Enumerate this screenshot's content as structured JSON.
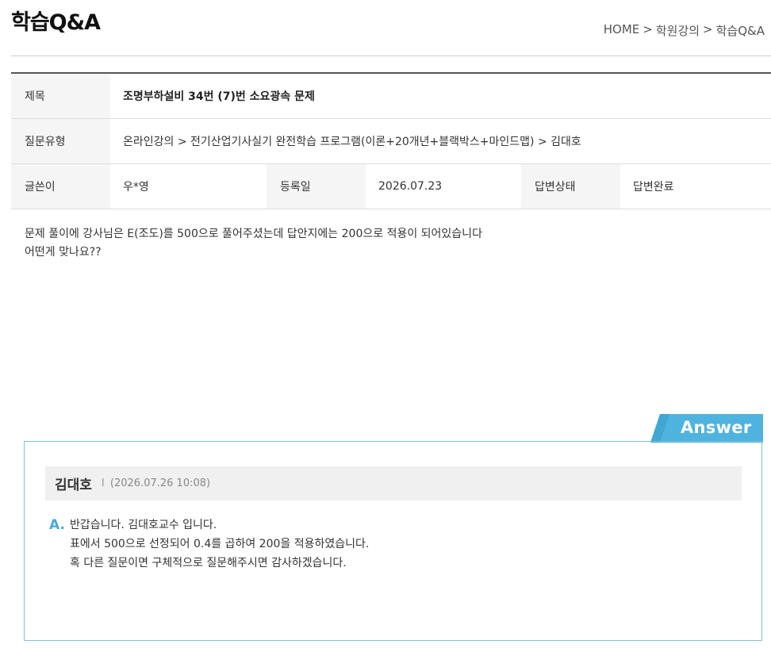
{
  "page": {
    "title": "학습Q&A"
  },
  "breadcrumb": {
    "items": [
      "HOME",
      "학원강의",
      "학습Q&A"
    ],
    "separator": ">"
  },
  "question": {
    "subject_label": "제목",
    "subject_value": "조명부하설비 34번 (7)번 소요광속 문제",
    "type_label": "질문유형",
    "type_value": "온라인강의 > 전기산업기사실기 완전학습 프로그램(이론+20개년+블랙박스+마인드맵) > 김대호",
    "author_label": "글쓴이",
    "author_value": "우*영",
    "date_label": "등록일",
    "date_value": "2026.07.23",
    "status_label": "답변상태",
    "status_value": "답변완료",
    "body_lines": [
      "문제 풀이에 강사님은 E(조도)를 500으로 풀어주셨는데 답안지에는 200으로 적용이 되어있습니다",
      "어떤게 맞나요??"
    ]
  },
  "answer": {
    "tab_label": "Answer",
    "author": "김대호",
    "meta_bar": "I",
    "datetime": "(2026.07.26 10:08)",
    "mark": "A.",
    "lines": [
      "반갑습니다. 김대호교수 입니다.",
      "표에서 500으로 선정되어 0.4를 곱하여 200을 적용하였습니다.",
      "혹 다른 질문이면 구체적으로 질문해주시면 감사하겠습니다."
    ]
  },
  "colors": {
    "accent": "#4aa8d8",
    "tab_fill": "#4eb3df",
    "border_answer": "#7fbfd9",
    "label_bg": "#f5f5f5"
  }
}
